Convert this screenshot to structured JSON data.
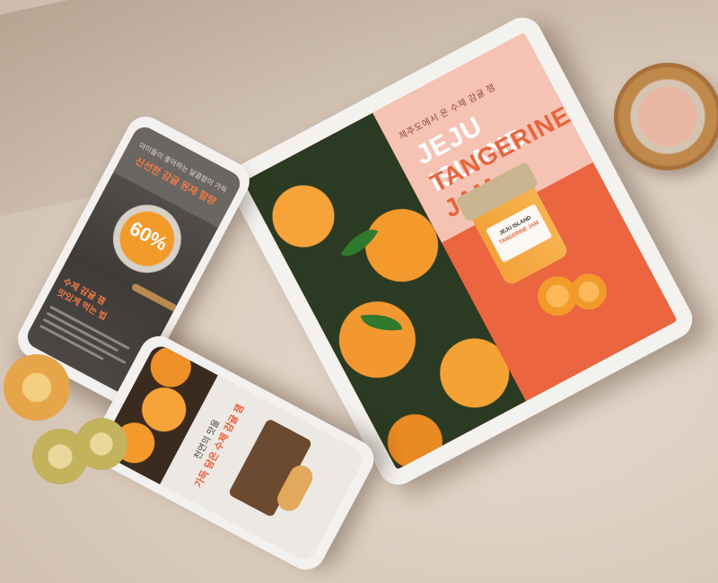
{
  "tablet": {
    "subtitle": "제주도에서 온 수제 감귤 잼",
    "title_line1": "JEJU ISLAND",
    "title_line2": "TANGERINE JAM",
    "jar_label_line1": "JEJU ISLAND",
    "jar_label_line2": "TANGERINE JAM"
  },
  "phone_left": {
    "header_line1": "아이들이 좋아하는 달콤함이 가득",
    "header_line2": "신선한 감귤 원재 함량",
    "percent": "60%",
    "caption_line1": "수제 감귤 잼",
    "caption_line2": "맛있게 먹는 법"
  },
  "phone_bottom": {
    "title_line1": "천연의 맛을",
    "title_line2": "가득 담은 수제 감귤 잼"
  },
  "colors": {
    "accent_orange": "#ea6540",
    "pink_panel": "#f6c2b3",
    "background": "#dccdbf"
  }
}
